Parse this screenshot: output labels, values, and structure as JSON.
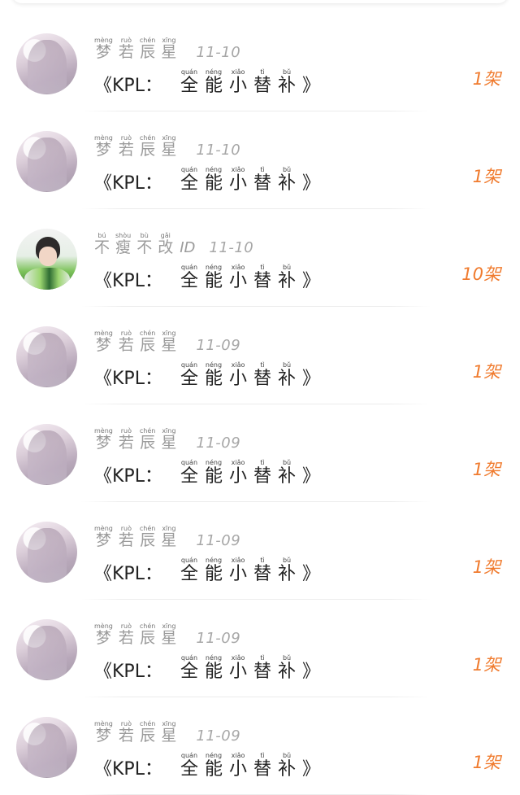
{
  "messages": [
    {
      "name": [
        {
          "ch": "梦",
          "py": "mèng"
        },
        {
          "ch": "若",
          "py": "ruò"
        },
        {
          "ch": "辰",
          "py": "chén"
        },
        {
          "ch": "星",
          "py": "xīng"
        }
      ],
      "name_suffix": "",
      "date": "11-10",
      "title_prefix": "《KPL：",
      "title_words": [
        {
          "ch": "全",
          "py": "quán"
        },
        {
          "ch": "能",
          "py": "néng"
        },
        {
          "ch": "小",
          "py": "xiǎo"
        },
        {
          "ch": "替",
          "py": "tì"
        },
        {
          "ch": "补",
          "py": "bǔ"
        }
      ],
      "title_suffix": "》",
      "count": "1架",
      "avatar": "anime-girl-avatar"
    },
    {
      "name": [
        {
          "ch": "梦",
          "py": "mèng"
        },
        {
          "ch": "若",
          "py": "ruò"
        },
        {
          "ch": "辰",
          "py": "chén"
        },
        {
          "ch": "星",
          "py": "xīng"
        }
      ],
      "name_suffix": "",
      "date": "11-10",
      "title_prefix": "《KPL：",
      "title_words": [
        {
          "ch": "全",
          "py": "quán"
        },
        {
          "ch": "能",
          "py": "néng"
        },
        {
          "ch": "小",
          "py": "xiǎo"
        },
        {
          "ch": "替",
          "py": "tì"
        },
        {
          "ch": "补",
          "py": "bǔ"
        }
      ],
      "title_suffix": "》",
      "count": "1架",
      "avatar": "anime-girl-avatar"
    },
    {
      "name": [
        {
          "ch": "不",
          "py": "bú"
        },
        {
          "ch": "瘦",
          "py": "shòu"
        },
        {
          "ch": "不",
          "py": "bù"
        },
        {
          "ch": "改",
          "py": "gǎi"
        }
      ],
      "name_suffix": "ID",
      "date": "11-10",
      "title_prefix": "《KPL：",
      "title_words": [
        {
          "ch": "全",
          "py": "quán"
        },
        {
          "ch": "能",
          "py": "néng"
        },
        {
          "ch": "小",
          "py": "xiǎo"
        },
        {
          "ch": "替",
          "py": "tì"
        },
        {
          "ch": "补",
          "py": "bǔ"
        }
      ],
      "title_suffix": "》",
      "count": "10架",
      "avatar": "skater-avatar"
    },
    {
      "name": [
        {
          "ch": "梦",
          "py": "mèng"
        },
        {
          "ch": "若",
          "py": "ruò"
        },
        {
          "ch": "辰",
          "py": "chén"
        },
        {
          "ch": "星",
          "py": "xīng"
        }
      ],
      "name_suffix": "",
      "date": "11-09",
      "title_prefix": "《KPL：",
      "title_words": [
        {
          "ch": "全",
          "py": "quán"
        },
        {
          "ch": "能",
          "py": "néng"
        },
        {
          "ch": "小",
          "py": "xiǎo"
        },
        {
          "ch": "替",
          "py": "tì"
        },
        {
          "ch": "补",
          "py": "bǔ"
        }
      ],
      "title_suffix": "》",
      "count": "1架",
      "avatar": "anime-girl-avatar"
    },
    {
      "name": [
        {
          "ch": "梦",
          "py": "mèng"
        },
        {
          "ch": "若",
          "py": "ruò"
        },
        {
          "ch": "辰",
          "py": "chén"
        },
        {
          "ch": "星",
          "py": "xīng"
        }
      ],
      "name_suffix": "",
      "date": "11-09",
      "title_prefix": "《KPL：",
      "title_words": [
        {
          "ch": "全",
          "py": "quán"
        },
        {
          "ch": "能",
          "py": "néng"
        },
        {
          "ch": "小",
          "py": "xiǎo"
        },
        {
          "ch": "替",
          "py": "tì"
        },
        {
          "ch": "补",
          "py": "bǔ"
        }
      ],
      "title_suffix": "》",
      "count": "1架",
      "avatar": "anime-girl-avatar"
    },
    {
      "name": [
        {
          "ch": "梦",
          "py": "mèng"
        },
        {
          "ch": "若",
          "py": "ruò"
        },
        {
          "ch": "辰",
          "py": "chén"
        },
        {
          "ch": "星",
          "py": "xīng"
        }
      ],
      "name_suffix": "",
      "date": "11-09",
      "title_prefix": "《KPL：",
      "title_words": [
        {
          "ch": "全",
          "py": "quán"
        },
        {
          "ch": "能",
          "py": "néng"
        },
        {
          "ch": "小",
          "py": "xiǎo"
        },
        {
          "ch": "替",
          "py": "tì"
        },
        {
          "ch": "补",
          "py": "bǔ"
        }
      ],
      "title_suffix": "》",
      "count": "1架",
      "avatar": "anime-girl-avatar"
    },
    {
      "name": [
        {
          "ch": "梦",
          "py": "mèng"
        },
        {
          "ch": "若",
          "py": "ruò"
        },
        {
          "ch": "辰",
          "py": "chén"
        },
        {
          "ch": "星",
          "py": "xīng"
        }
      ],
      "name_suffix": "",
      "date": "11-09",
      "title_prefix": "《KPL：",
      "title_words": [
        {
          "ch": "全",
          "py": "quán"
        },
        {
          "ch": "能",
          "py": "néng"
        },
        {
          "ch": "小",
          "py": "xiǎo"
        },
        {
          "ch": "替",
          "py": "tì"
        },
        {
          "ch": "补",
          "py": "bǔ"
        }
      ],
      "title_suffix": "》",
      "count": "1架",
      "avatar": "anime-girl-avatar"
    },
    {
      "name": [
        {
          "ch": "梦",
          "py": "mèng"
        },
        {
          "ch": "若",
          "py": "ruò"
        },
        {
          "ch": "辰",
          "py": "chén"
        },
        {
          "ch": "星",
          "py": "xīng"
        }
      ],
      "name_suffix": "",
      "date": "11-09",
      "title_prefix": "《KPL：",
      "title_words": [
        {
          "ch": "全",
          "py": "quán"
        },
        {
          "ch": "能",
          "py": "néng"
        },
        {
          "ch": "小",
          "py": "xiǎo"
        },
        {
          "ch": "替",
          "py": "tì"
        },
        {
          "ch": "补",
          "py": "bǔ"
        }
      ],
      "title_suffix": "》",
      "count": "1架",
      "avatar": "anime-girl-avatar"
    }
  ],
  "colors": {
    "count": "#f07b2e",
    "meta": "#9b9b9b",
    "title": "#222222"
  }
}
